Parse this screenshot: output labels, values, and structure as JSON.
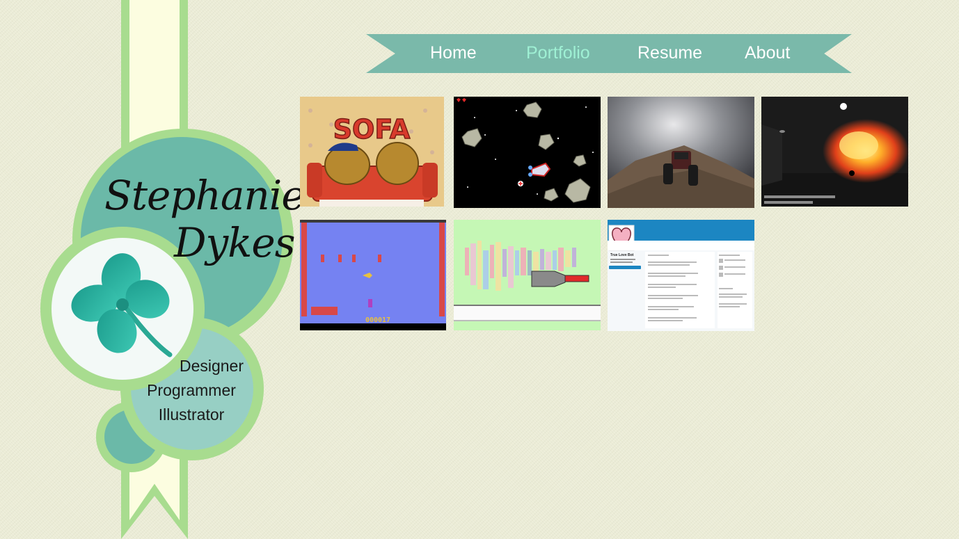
{
  "brand": {
    "first_name": "Stephanie",
    "last_name": "Dykes",
    "roles": [
      "Designer",
      "Programmer",
      "Illustrator"
    ],
    "logo_icon": "four-leaf-clover-icon"
  },
  "nav": {
    "items": [
      {
        "label": "Home",
        "active": false
      },
      {
        "label": "Portfolio",
        "active": true
      },
      {
        "label": "Resume",
        "active": false
      },
      {
        "label": "About",
        "active": false
      }
    ],
    "banner_color": "#7ab9aa",
    "active_color": "#9ff0d4"
  },
  "portfolio": {
    "items": [
      {
        "name": "sofa-potatoes-game",
        "title_text": "SOFA"
      },
      {
        "name": "space-asteroids-game"
      },
      {
        "name": "monster-truck-3d"
      },
      {
        "name": "explosion-fps"
      },
      {
        "name": "atari-fish-game",
        "score_text": "000017"
      },
      {
        "name": "pastel-paint-cannon"
      },
      {
        "name": "true-love-bot-twitter",
        "account_name": "True Love Bot"
      }
    ]
  },
  "colors": {
    "background": "#ebecd6",
    "ribbon_green": "#a8dc8f",
    "teal": "#6bb9a8",
    "light_teal": "#97cfc4",
    "cream": "#fcfde0"
  }
}
